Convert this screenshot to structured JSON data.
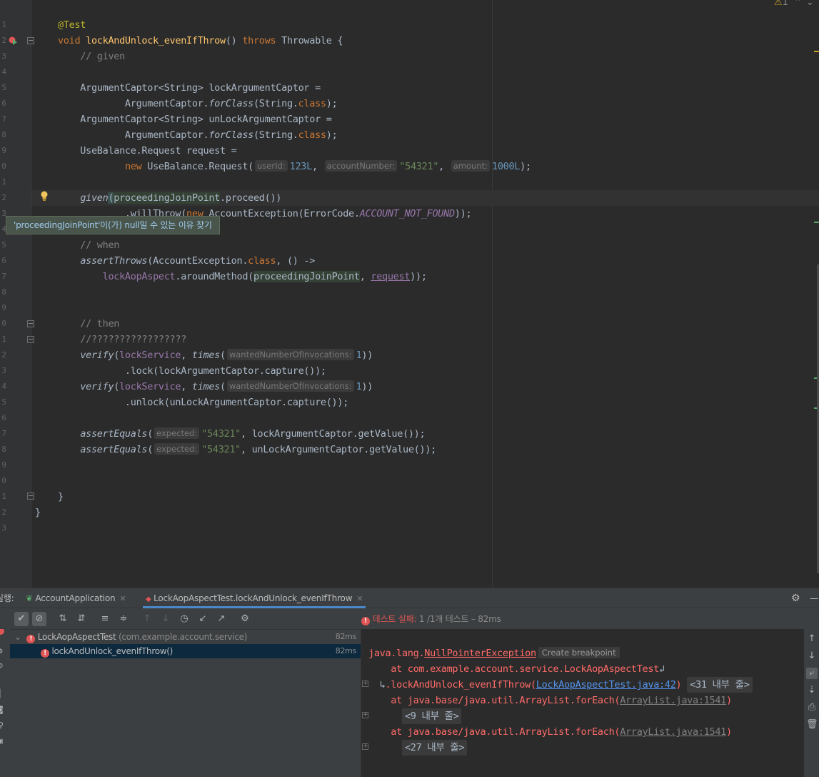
{
  "editor": {
    "line_numbers": [
      "1",
      "2",
      "3",
      "4",
      "5",
      "6",
      "7",
      "8",
      "9",
      "0",
      "1",
      "2",
      "3",
      "4",
      "5",
      "6",
      "7",
      "8",
      "9",
      "0",
      "1",
      "2",
      "3",
      "4",
      "5",
      "6",
      "7",
      "8",
      "9",
      "0",
      "1",
      "2",
      "3"
    ],
    "code": {
      "l01": "@Test",
      "l02_kw": "void ",
      "l02_fn": "lockAndUnlock_evenIfThrow",
      "l02_a": "() ",
      "l02_throws": "throws",
      "l02_b": " Throwable {",
      "l03": "    // given",
      "l05": "    ArgumentCaptor<String> lockArgumentCaptor =",
      "l06_a": "            ArgumentCaptor.",
      "l06_b": "forClass",
      "l06_c": "(String.",
      "l06_d": "class",
      "l06_e": ");",
      "l07": "    ArgumentCaptor<String> unLockArgumentCaptor =",
      "l08_a": "            ArgumentCaptor.",
      "l08_b": "forClass",
      "l08_c": "(String.",
      "l08_d": "class",
      "l08_e": ");",
      "l09": "    UseBalance.Request request =",
      "l10_a": "            ",
      "l10_new": "new",
      "l10_b": " UseBalance.Request(",
      "l10_h1": "userId:",
      "l10_v1": "123L",
      "l10_c": ", ",
      "l10_h2": "accountNumber:",
      "l10_v2": "\"54321\"",
      "l10_d": ", ",
      "l10_h3": "amount:",
      "l10_v3": "1000L",
      "l10_e": ");",
      "l12_a": "    ",
      "l12_given": "given",
      "l12_b": "(",
      "l12_pjp": "proceedingJoinPoint",
      "l12_c": ".proceed())",
      "l13_a": "            .willThrow(",
      "l13_new": "new",
      "l13_b": " AccountException(ErrorCode.",
      "l13_const": "ACCOUNT_NOT_FOUND",
      "l13_c": "));",
      "l15": "    // when",
      "l16_a": "    ",
      "l16_at": "assertThrows",
      "l16_b": "(AccountException.",
      "l16_class": "class",
      "l16_c": ", () ->",
      "l17_a": "        ",
      "l17_field": "lockAopAspect",
      "l17_b": ".aroundMethod(",
      "l17_pjp": "proceedingJoinPoint",
      "l17_c": ", ",
      "l17_req": "request",
      "l17_d": "));",
      "l20": "    // then",
      "l21": "    //?????????????????",
      "l22_a": "    ",
      "l22_verify": "verify",
      "l22_b": "(",
      "l22_field": "lockService",
      "l22_c": ", ",
      "l22_times": "times",
      "l22_d": "(",
      "l22_hint": "wantedNumberOfInvocations:",
      "l22_num": "1",
      "l22_e": "))",
      "l23": "            .lock(lockArgumentCaptor.capture());",
      "l24_a": "    ",
      "l24_verify": "verify",
      "l24_b": "(",
      "l24_field": "lockService",
      "l24_c": ", ",
      "l24_times": "times",
      "l24_d": "(",
      "l24_hint": "wantedNumberOfInvocations:",
      "l24_num": "1",
      "l24_e": "))",
      "l25": "            .unlock(unLockArgumentCaptor.capture());",
      "l27_a": "    ",
      "l27_ae": "assertEquals",
      "l27_b": "(",
      "l27_hint": "expected:",
      "l27_str": "\"54321\"",
      "l27_c": ", lockArgumentCaptor.getValue());",
      "l28_a": "    ",
      "l28_ae": "assertEquals",
      "l28_b": "(",
      "l28_hint": "expected:",
      "l28_str": "\"54321\"",
      "l28_c": ", unLockArgumentCaptor.getValue());",
      "l31": "}",
      "l32": "}"
    },
    "tooltip": "'proceedingJoinPoint'이(가) null일 수 있는 이유 찾기",
    "warning_count": "1"
  },
  "toolwindow": {
    "label": "실행:",
    "tabs": [
      {
        "label": "AccountApplication"
      },
      {
        "label": "LockAopAspectTest.lockAndUnlock_evenIfThrow"
      }
    ],
    "status_prefix": "테스트 실패:",
    "status_rest": " 1 /1개 테스트 – 82ms",
    "tree": [
      {
        "name": "LockAopAspectTest",
        "package": "(com.example.account.service)",
        "time": "82ms"
      },
      {
        "name": "lockAndUnlock_evenIfThrow()",
        "time": "82ms"
      }
    ],
    "console": {
      "exc_pkg": "java.lang.",
      "exc_name": "NullPointerException",
      "create_bp": "Create breakpoint",
      "at1": "    at com.example.account.service.LockAopAspectTest",
      "at1_b": ".lockAndUnlock_evenIfThrow(",
      "link1": "LockAopAspectTest.java:42",
      "fold1": "<31 내부 줄>",
      "at2": "    at java.base/java.util.ArrayList.forEach(",
      "link2": "ArrayList.java:1541",
      "fold2": "<9 내부 줄>",
      "at3": "    at java.base/java.util.ArrayList.forEach(",
      "link3": "ArrayList.java:1541",
      "fold3": "<27 내부 줄>",
      "close_paren": ")"
    }
  }
}
